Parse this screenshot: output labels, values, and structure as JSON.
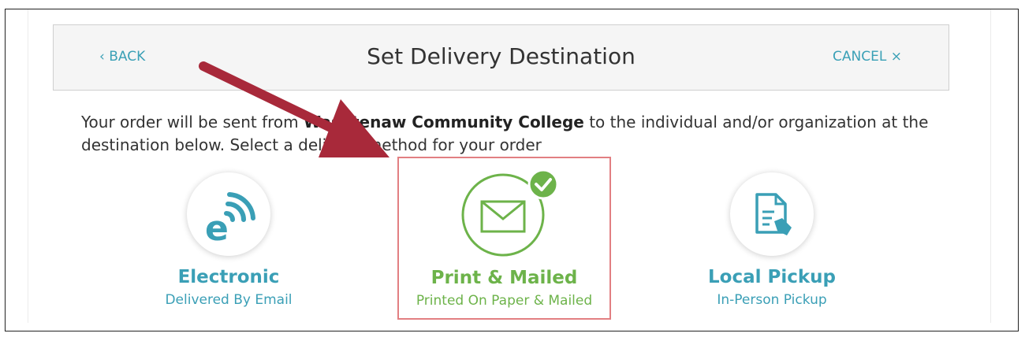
{
  "header": {
    "back_label": "‹ BACK",
    "title": "Set Delivery Destination",
    "cancel_label": "CANCEL ×"
  },
  "description": {
    "prefix": "Your order will be sent from ",
    "institution": "Washtenaw Community College",
    "suffix": " to the individual and/or organization at the destination below. Select a delivery method for your order"
  },
  "options": [
    {
      "label": "Electronic",
      "sublabel": "Delivered By Email",
      "icon": "ebook-wifi-icon",
      "selected": false
    },
    {
      "label": "Print & Mailed",
      "sublabel": "Printed On Paper & Mailed",
      "icon": "envelope-icon",
      "selected": true
    },
    {
      "label": "Local Pickup",
      "sublabel": "In-Person Pickup",
      "icon": "document-hand-icon",
      "selected": false
    }
  ],
  "colors": {
    "accent_teal": "#3a9fb6",
    "selected_green": "#6db34a",
    "selected_border": "#e27f82",
    "annotation_arrow": "#a8293a"
  }
}
